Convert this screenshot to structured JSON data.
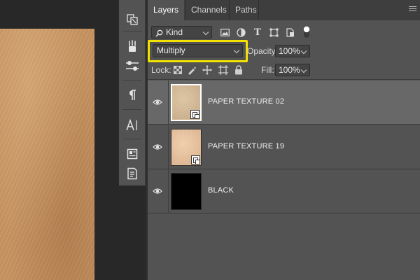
{
  "panel": {
    "tabs": [
      {
        "label": "Layers",
        "active": true
      },
      {
        "label": "Channels",
        "active": false
      },
      {
        "label": "Paths",
        "active": false
      }
    ]
  },
  "filter": {
    "kind_label": "Kind",
    "icons": [
      "image-filter-icon",
      "adjustment-filter-icon",
      "type-filter-icon",
      "shape-filter-icon",
      "smart-object-filter-icon",
      "filter-toggle-icon"
    ]
  },
  "blend": {
    "mode": "Multiply",
    "opacity_label": "Opacity:",
    "opacity_value": "100%"
  },
  "lock": {
    "label": "Lock:",
    "icons": [
      "lock-transparent-pixels-icon",
      "lock-image-pixels-icon",
      "lock-position-icon",
      "lock-artboard-icon",
      "lock-all-icon"
    ],
    "fill_label": "Fill:",
    "fill_value": "100%"
  },
  "layers": [
    {
      "name": "PAPER TEXTURE 02",
      "selected": true,
      "visible": true,
      "smart_object": true
    },
    {
      "name": "PAPER TEXTURE 19",
      "selected": false,
      "visible": true,
      "smart_object": true
    },
    {
      "name": "BLACK",
      "selected": false,
      "visible": true,
      "smart_object": false
    }
  ],
  "toolbar": {
    "icons": [
      "layer-comps-icon",
      "brushes-icon",
      "adjustments-icon",
      "paragraph-icon",
      "character-icon",
      "properties-icon",
      "notes-icon"
    ]
  },
  "colors": {
    "highlight": "#f4e100",
    "panel_bg": "#535353",
    "selected_row": "#686868"
  }
}
